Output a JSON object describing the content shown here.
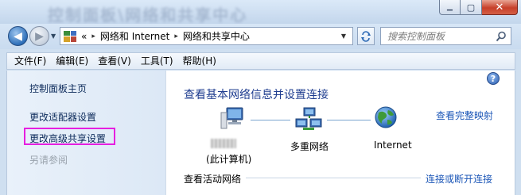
{
  "window": {
    "title_blurred": "控制面板\\网络和共享中心",
    "caption_buttons": {
      "minimize": "▁",
      "maximize": "▢",
      "close": "✕"
    }
  },
  "nav": {
    "address": {
      "prefix": "«",
      "segments": [
        "网络和 Internet",
        "网络和共享中心"
      ],
      "separator": "▸",
      "dropdown": "▼"
    },
    "refresh_icon": "refresh-arrows",
    "search": {
      "placeholder": "搜索控制面板",
      "value": ""
    }
  },
  "menu": [
    "文件(F)",
    "编辑(E)",
    "查看(V)",
    "工具(T)",
    "帮助(H)"
  ],
  "sidebar": {
    "links": [
      "控制面板主页",
      "更改适配器设置",
      "更改高级共享设置"
    ],
    "highlighted_index": 2,
    "see_also": "另请参阅"
  },
  "main": {
    "help": "?",
    "title": "查看基本网络信息并设置连接",
    "full_map": "查看完整映射",
    "nodes": [
      {
        "label": "(此计算机)",
        "icon": "computer-icon"
      },
      {
        "label": "多重网络",
        "icon": "network-icon"
      },
      {
        "label": "Internet",
        "icon": "globe-icon"
      }
    ],
    "active_networks": "查看活动网络",
    "connect_disconnect": "连接或断开连接"
  },
  "colors": {
    "link": "#1e58b8",
    "title": "#1e3c8f",
    "highlight": "#e61fe0"
  }
}
